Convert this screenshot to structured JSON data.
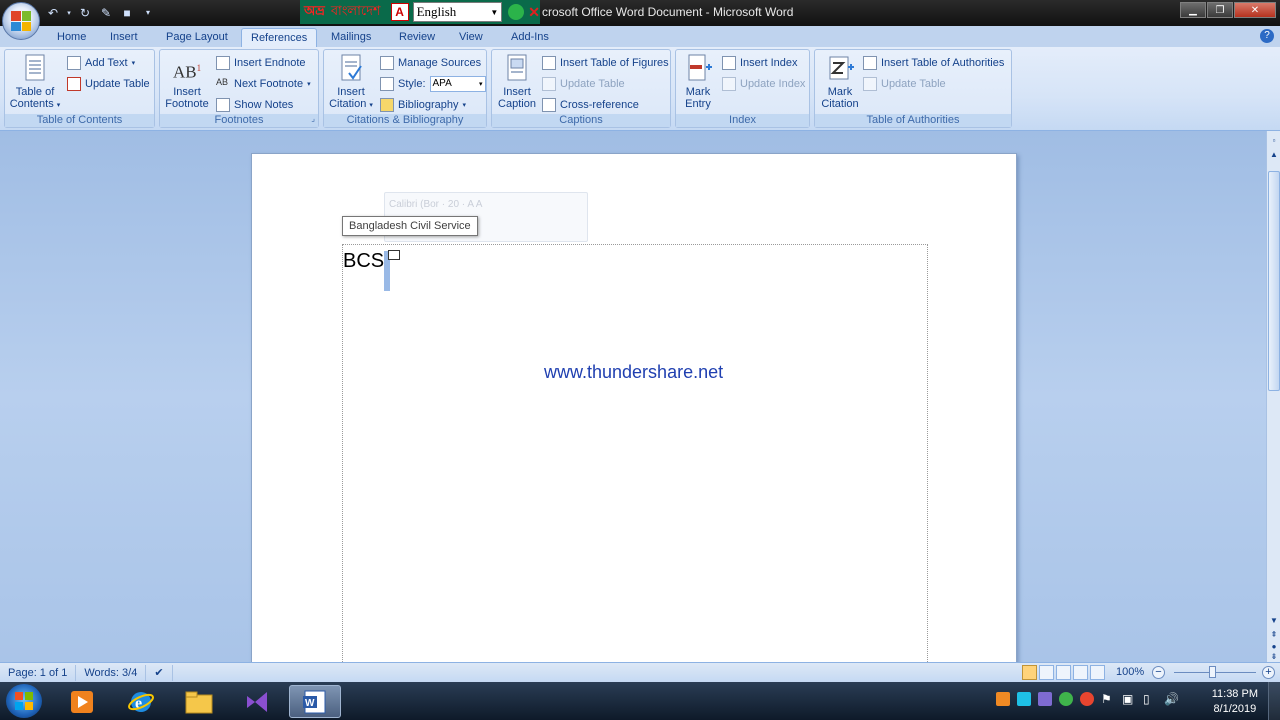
{
  "window": {
    "title": "crosoft Office Word Document - Microsoft Word"
  },
  "quick_access": {
    "icons": [
      "undo-icon",
      "redo-icon",
      "edit-icon",
      "save-icon",
      "customize-icon"
    ]
  },
  "bangla_bar": {
    "logo": "অভ্র",
    "text": "বাংলাদেশ",
    "language": "English"
  },
  "tabs": [
    {
      "label": "Home",
      "active": false
    },
    {
      "label": "Insert",
      "active": false
    },
    {
      "label": "Page Layout",
      "active": false
    },
    {
      "label": "References",
      "active": true
    },
    {
      "label": "Mailings",
      "active": false
    },
    {
      "label": "Review",
      "active": false
    },
    {
      "label": "View",
      "active": false
    },
    {
      "label": "Add-Ins",
      "active": false
    }
  ],
  "ribbon": {
    "toc": {
      "label": "Table of Contents",
      "big_line1": "Table of",
      "big_line2": "Contents",
      "add_text": "Add Text",
      "update_table": "Update Table"
    },
    "footnotes": {
      "label": "Footnotes",
      "insert_line1": "Insert",
      "insert_line2": "Footnote",
      "insert_endnote": "Insert Endnote",
      "next_footnote": "Next Footnote",
      "show_notes": "Show Notes"
    },
    "citations": {
      "label": "Citations & Bibliography",
      "insert_line1": "Insert",
      "insert_line2": "Citation",
      "manage_sources": "Manage Sources",
      "style_label": "Style:",
      "style_value": "APA",
      "bibliography": "Bibliography"
    },
    "captions": {
      "label": "Captions",
      "insert_line1": "Insert",
      "insert_line2": "Caption",
      "insert_tof": "Insert Table of Figures",
      "update_table": "Update Table",
      "cross_reference": "Cross-reference"
    },
    "index": {
      "label": "Index",
      "mark_line1": "Mark",
      "mark_line2": "Entry",
      "insert_index": "Insert Index",
      "update_index": "Update Index"
    },
    "authorities": {
      "label": "Table of Authorities",
      "mark_line1": "Mark",
      "mark_line2": "Citation",
      "insert_toa": "Insert Table of Authorities",
      "update_table": "Update Table"
    }
  },
  "document": {
    "body_text": "BCS",
    "tooltip": "Bangladesh Civil Service",
    "mini_toolbar_font": "Calibri (Bor",
    "mini_toolbar_size": "20",
    "watermark": "www.thundershare.net"
  },
  "statusbar": {
    "page": "Page: 1 of 1",
    "words": "Words: 3/4",
    "zoom": "100%"
  },
  "taskbar": {
    "apps": [
      "media-player-icon",
      "internet-explorer-icon",
      "file-explorer-icon",
      "visual-studio-icon",
      "word-icon"
    ],
    "time": "11:38 PM",
    "date": "8/1/2019"
  },
  "colors": {
    "ribbon_text": "#15428b",
    "active_tab": "#e3edfb",
    "watermark": "#1f3fb0",
    "highlight": "#99b9e6"
  }
}
